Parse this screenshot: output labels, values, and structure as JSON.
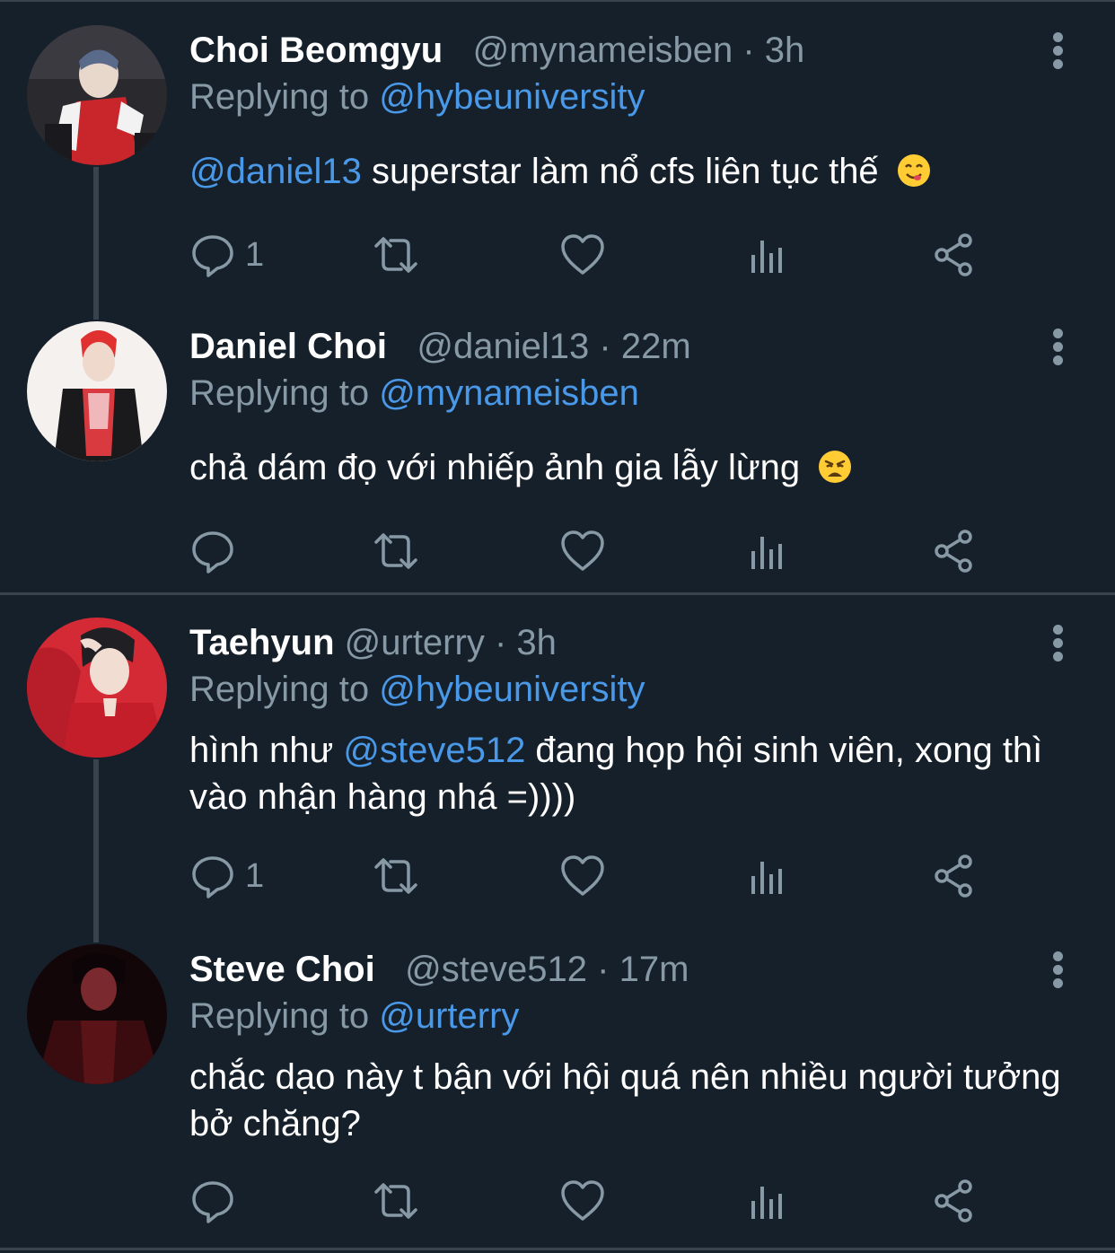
{
  "tweets": [
    {
      "name": "Choi Beomgyu",
      "handle": "@mynameisben",
      "sep": "·",
      "time": "3h",
      "replying_prefix": "Replying to",
      "replying_to": "@hybeuniversity",
      "mention": "@daniel13",
      "text": " superstar làm nổ cfs liên tục thế",
      "emoji": "yum-face-emoji",
      "reply_count": "1"
    },
    {
      "name": "Daniel Choi",
      "handle": "@daniel13",
      "sep": "·",
      "time": "22m",
      "replying_prefix": "Replying to",
      "replying_to": "@mynameisben",
      "text": "chả dám đọ với nhiếp ảnh gia lẫy lừng",
      "emoji": "weary-face-emoji",
      "reply_count": ""
    },
    {
      "name": "Taehyun",
      "handle": "@urterry",
      "sep": "·",
      "time": "3h",
      "replying_prefix": "Replying to",
      "replying_to": "@hybeuniversity",
      "text_before": "hình như ",
      "mention": "@steve512",
      "text_after": " đang họp hội sinh viên, xong thì vào nhận hàng nhá =))))",
      "reply_count": "1"
    },
    {
      "name": "Steve Choi",
      "handle": "@steve512",
      "sep": "·",
      "time": "17m",
      "replying_prefix": "Replying to",
      "replying_to": "@urterry",
      "text": "chắc dạo này t bận với hội quá nên nhiều người tưởng bở chăng?",
      "reply_count": ""
    }
  ],
  "icons": {
    "reply": "reply-icon",
    "retweet": "retweet-icon",
    "like": "like-icon",
    "analytics": "analytics-icon",
    "share": "share-icon",
    "more": "more-icon"
  },
  "colors": {
    "background": "#15202b",
    "secondary_text": "#8899a6",
    "link": "#4a99e9",
    "divider": "#38444d"
  }
}
